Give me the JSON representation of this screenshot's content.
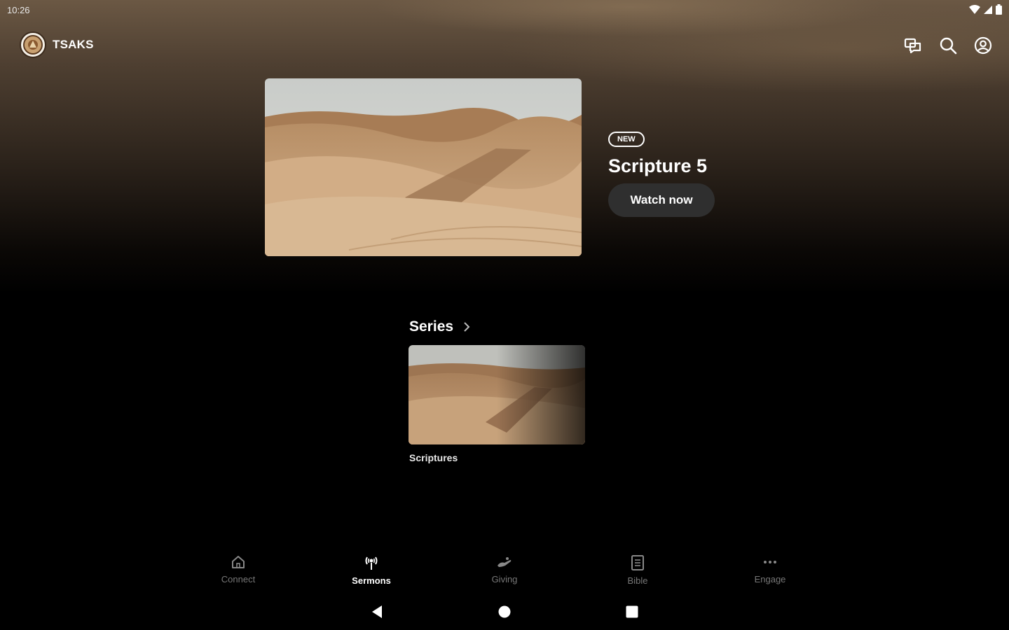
{
  "status_bar": {
    "time": "10:26"
  },
  "header": {
    "brand": "TSAKS",
    "icons": [
      "chat-icon",
      "search-icon",
      "account-icon"
    ]
  },
  "hero": {
    "badge": "NEW",
    "title": "Scripture 5",
    "button_label": "Watch now"
  },
  "series": {
    "heading": "Series",
    "items": [
      {
        "label": "Scriptures"
      }
    ]
  },
  "bottom_nav": {
    "items": [
      {
        "label": "Connect",
        "icon": "home-icon",
        "active": false
      },
      {
        "label": "Sermons",
        "icon": "sermons-icon",
        "active": true
      },
      {
        "label": "Giving",
        "icon": "giving-icon",
        "active": false
      },
      {
        "label": "Bible",
        "icon": "bible-icon",
        "active": false
      },
      {
        "label": "Engage",
        "icon": "more-icon",
        "active": false
      }
    ]
  },
  "colors": {
    "background": "#000000",
    "hero_top": "#6b5844",
    "button": "#2f2f2f",
    "inactive_nav": "#777777"
  }
}
